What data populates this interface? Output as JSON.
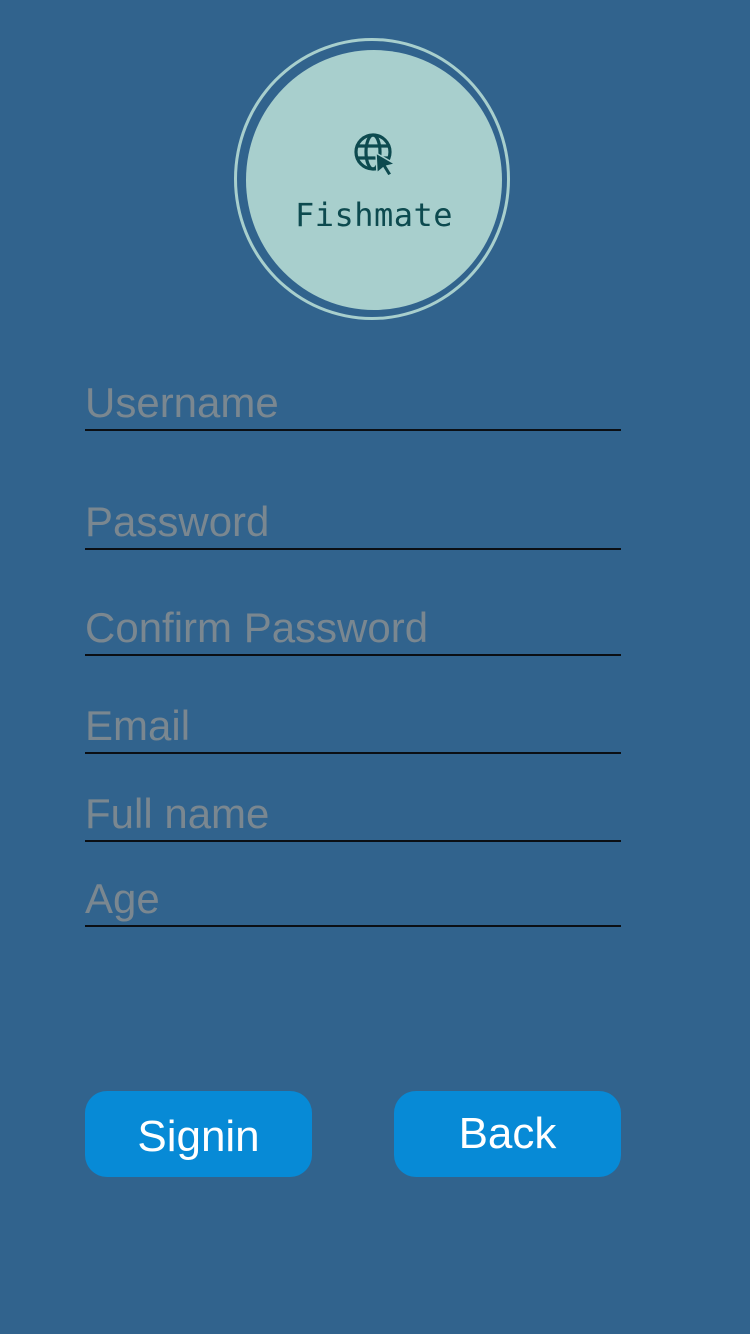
{
  "app": {
    "logo_text": "Fishmate",
    "logo_icon": "globe-cursor-icon"
  },
  "form": {
    "username": {
      "placeholder": "Username",
      "value": ""
    },
    "password": {
      "placeholder": "Password",
      "value": ""
    },
    "confirm_password": {
      "placeholder": "Confirm Password",
      "value": ""
    },
    "email": {
      "placeholder": "Email",
      "value": ""
    },
    "full_name": {
      "placeholder": "Full name",
      "value": ""
    },
    "age": {
      "placeholder": "Age",
      "value": ""
    }
  },
  "buttons": {
    "signin_label": "Signin",
    "back_label": "Back"
  },
  "colors": {
    "background": "#31638d",
    "logo_circle": "#a8cfcd",
    "logo_text": "#0d4a4f",
    "button": "#078ad6",
    "placeholder": "#7a8790",
    "underline": "#0b0f14"
  }
}
